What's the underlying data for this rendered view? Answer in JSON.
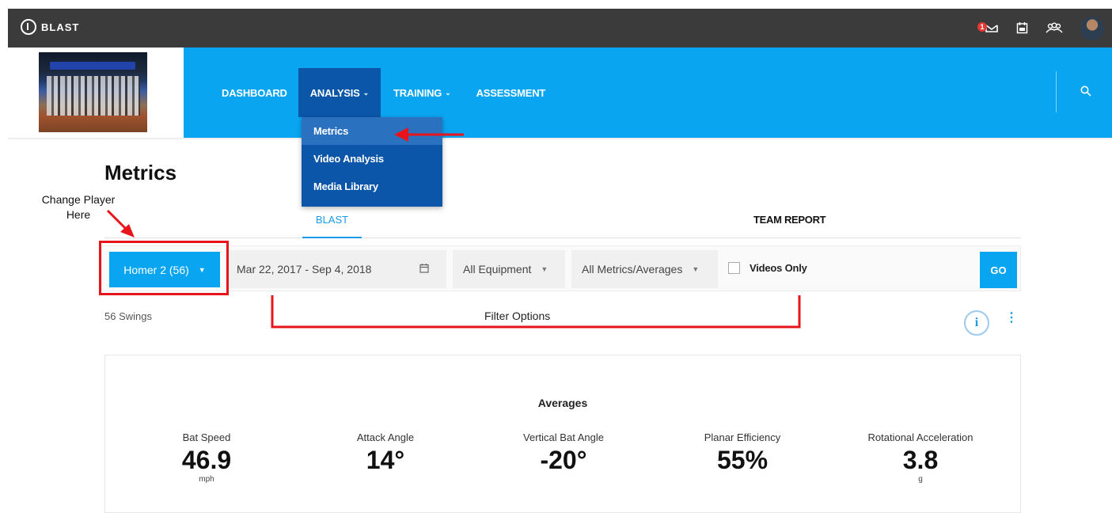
{
  "app": {
    "brand": "BLAST",
    "notification_count": "1",
    "icons": [
      "logo-icon",
      "inbox-icon",
      "calendar-icon",
      "team-icon",
      "avatar"
    ]
  },
  "nav": {
    "items": [
      {
        "label": "DASHBOARD",
        "has_menu": false
      },
      {
        "label": "ANALYSIS",
        "has_menu": true,
        "active": true
      },
      {
        "label": "TRAINING",
        "has_menu": true
      },
      {
        "label": "ASSESSMENT",
        "has_menu": false
      }
    ],
    "dropdown": [
      "Metrics",
      "Video Analysis",
      "Media Library"
    ]
  },
  "page": {
    "title": "Metrics",
    "tabs": [
      "BLAST",
      "TEAM REPORT"
    ],
    "active_tab": "BLAST"
  },
  "filters": {
    "player": "Homer 2 (56)",
    "date_range": "Mar 22, 2017 - Sep 4, 2018",
    "equipment": "All Equipment",
    "metrics": "All Metrics/Averages",
    "videos_only_label": "Videos Only",
    "videos_only_checked": false,
    "go_label": "GO"
  },
  "summary": {
    "swings": "56 Swings"
  },
  "averages": {
    "title": "Averages",
    "metrics": [
      {
        "label": "Bat Speed",
        "value": "46.9",
        "unit": "mph"
      },
      {
        "label": "Attack Angle",
        "value": "14°",
        "unit": ""
      },
      {
        "label": "Vertical Bat Angle",
        "value": "-20°",
        "unit": ""
      },
      {
        "label": "Planar Efficiency",
        "value": "55%",
        "unit": ""
      },
      {
        "label": "Rotational Acceleration",
        "value": "3.8",
        "unit": "g"
      }
    ]
  },
  "annotations": {
    "change_player": "Change Player Here",
    "filter_options": "Filter Options",
    "color": "#e8141c"
  },
  "colors": {
    "topbar": "#3b3b3b",
    "primary": "#0aa5f1",
    "nav_active": "#0b56a8"
  }
}
